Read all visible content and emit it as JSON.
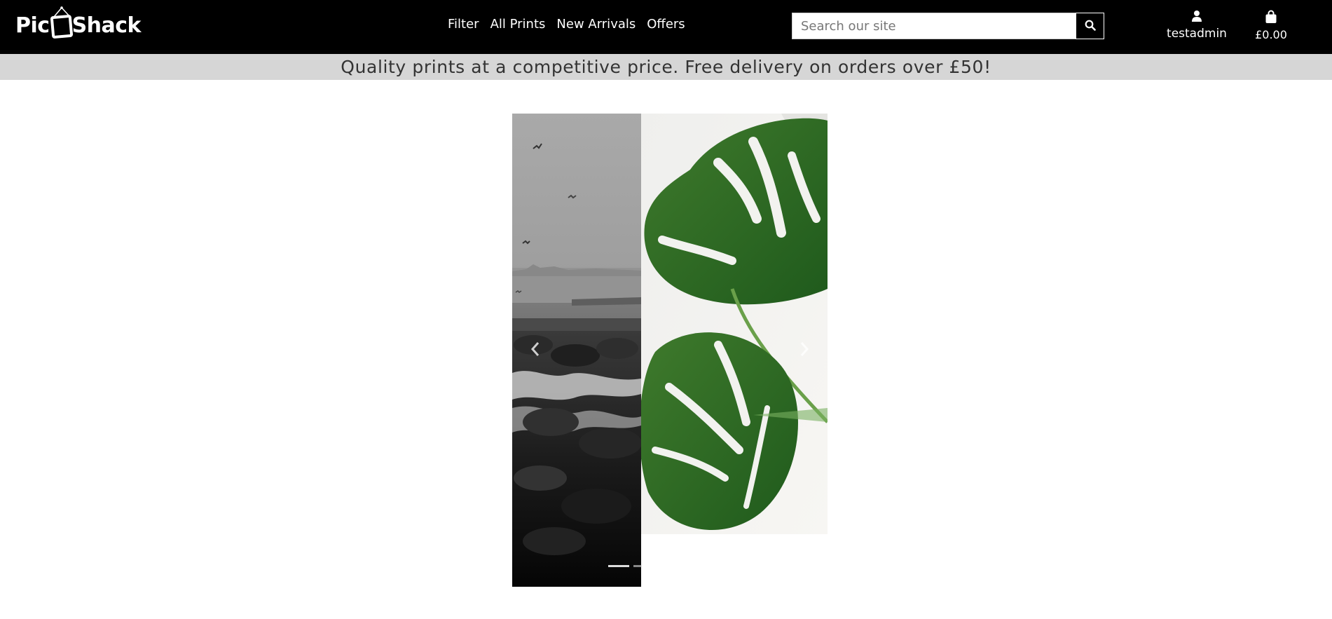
{
  "brand": {
    "logo_text_left": "Pic",
    "logo_text_right": "Shack"
  },
  "nav": {
    "items": [
      {
        "label": "Filter"
      },
      {
        "label": "All Prints"
      },
      {
        "label": "New Arrivals"
      },
      {
        "label": "Offers"
      }
    ]
  },
  "search": {
    "placeholder": "Search our site",
    "value": "",
    "icon": "search-icon"
  },
  "account": {
    "label": "testadmin",
    "icon": "user-icon"
  },
  "bag": {
    "label": "£0.00",
    "icon": "shopping-bag-icon"
  },
  "banner": {
    "text": "Quality prints at a competitive price. Free delivery on orders over £50!"
  },
  "carousel": {
    "slides": [
      {
        "image": "black-and-white-sea-rocks-birds"
      },
      {
        "image": "green-monstera-leaves"
      }
    ],
    "prev_icon": "chevron-left-icon",
    "next_icon": "chevron-right-icon",
    "indicator_count": 2,
    "active_index": 0
  },
  "colors": {
    "header_bg": "#000000",
    "banner_bg": "#d6d6d6",
    "accent": "#ffffff"
  }
}
